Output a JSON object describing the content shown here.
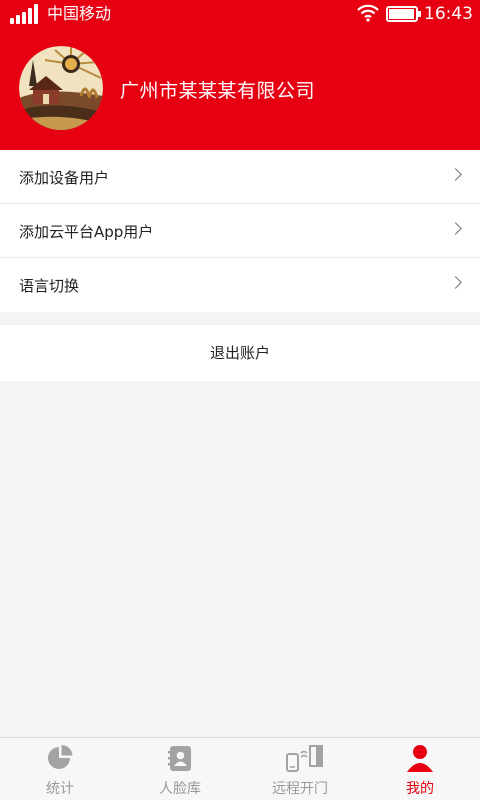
{
  "status_bar": {
    "carrier": "中国移动",
    "time": "16:43"
  },
  "profile": {
    "company_name": "广州市某某某有限公司"
  },
  "menu": {
    "items": [
      {
        "label": "添加设备用户"
      },
      {
        "label": "添加云平台App用户"
      },
      {
        "label": "语言切换"
      }
    ]
  },
  "logout": {
    "label": "退出账户"
  },
  "tabbar": {
    "tabs": [
      {
        "label": "统计",
        "icon": "pie-chart-icon"
      },
      {
        "label": "人脸库",
        "icon": "contacts-icon"
      },
      {
        "label": "远程开门",
        "icon": "remote-door-icon"
      },
      {
        "label": "我的",
        "icon": "user-icon"
      }
    ],
    "active_index": 3
  },
  "colors": {
    "brand": "#e60012",
    "inactive": "#999999",
    "background": "#f4f4f4"
  }
}
